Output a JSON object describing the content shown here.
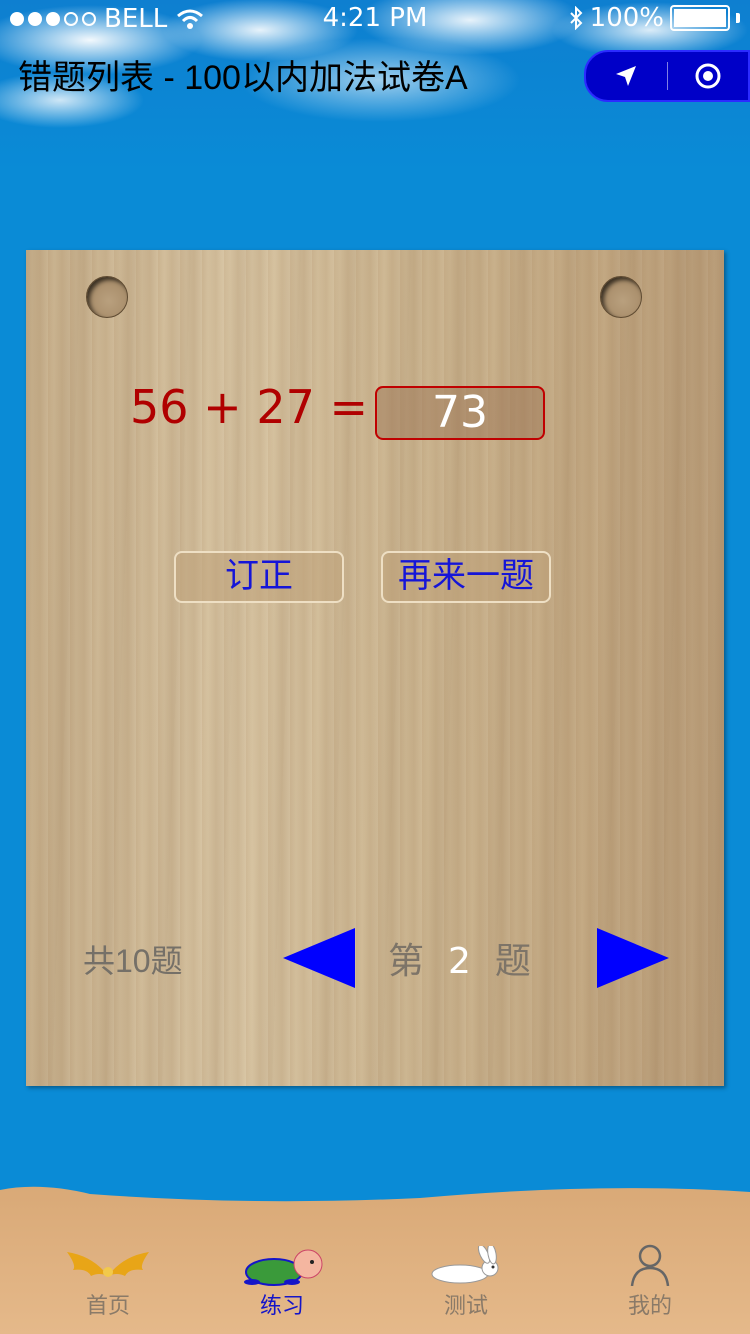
{
  "status_bar": {
    "carrier": "BELL",
    "time": "4:21 PM",
    "battery": "100%"
  },
  "nav": {
    "title": "错题列表 - 100以内加法试卷A"
  },
  "question": {
    "equation": "56 + 27 =",
    "answer": "73"
  },
  "buttons": {
    "correct": "订正",
    "retry": "再来一题"
  },
  "pager": {
    "total": "共10题",
    "prefix": "第",
    "current": "2",
    "suffix": "题"
  },
  "tabbar": {
    "items": [
      {
        "label": "首页",
        "icon": "wings-icon"
      },
      {
        "label": "练习",
        "icon": "turtle-icon"
      },
      {
        "label": "测试",
        "icon": "rabbit-icon"
      },
      {
        "label": "我的",
        "icon": "person-icon"
      }
    ],
    "active_index": 1,
    "active_color": "#1515c8"
  },
  "colors": {
    "sky": "#0a8bd6",
    "equation": "#b00000",
    "button_text": "#1515d8",
    "arrow": "#0000ff"
  }
}
